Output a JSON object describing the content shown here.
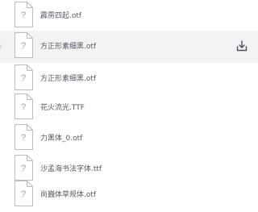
{
  "file_list": {
    "items": [
      {
        "name": "霹雳四起.otf",
        "icon": "unknown-file-icon",
        "hovered": false
      },
      {
        "name": "方正形素细黑.otf",
        "icon": "unknown-file-icon",
        "hovered": true,
        "action_icon": "download-icon"
      },
      {
        "name": "方正形素细黑.otf",
        "icon": "unknown-file-icon",
        "hovered": false
      },
      {
        "name": "花火流光.TTF",
        "icon": "unknown-file-icon",
        "hovered": false
      },
      {
        "name": "力黑体_0.otf",
        "icon": "unknown-file-icon",
        "hovered": false
      },
      {
        "name": "沙孟海书法字体.ttf",
        "icon": "unknown-file-icon",
        "hovered": false
      },
      {
        "name": "尚巍体草规体.otf",
        "icon": "unknown-file-icon",
        "hovered": false
      }
    ]
  },
  "colors": {
    "hover_background": "#f2f3f5",
    "text": "#555a62",
    "icon_stroke": "#b8bcc4",
    "icon_glyph": "#9aa0a8",
    "download_icon": "#4b5058"
  }
}
